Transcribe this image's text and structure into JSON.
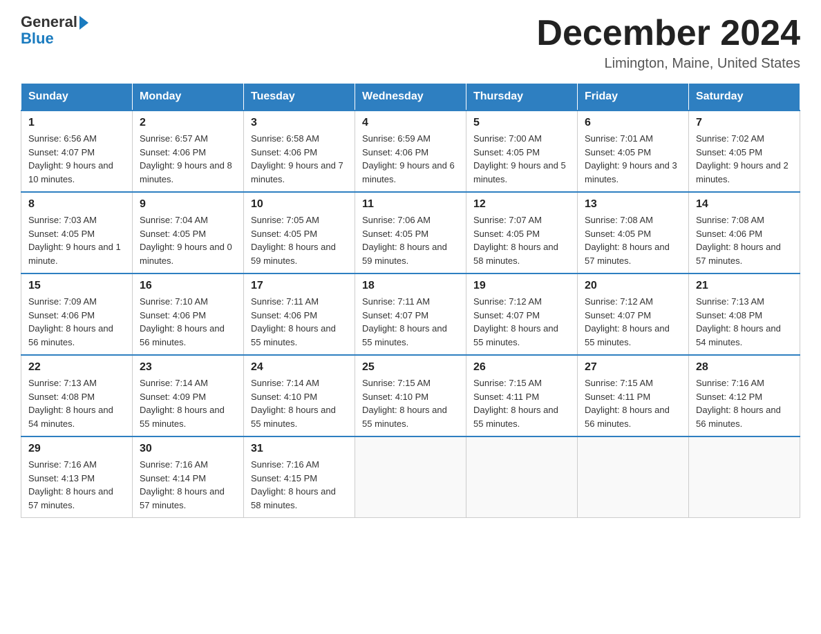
{
  "header": {
    "logo_text_general": "General",
    "logo_text_blue": "Blue",
    "month_title": "December 2024",
    "location": "Limington, Maine, United States"
  },
  "days_of_week": [
    "Sunday",
    "Monday",
    "Tuesday",
    "Wednesday",
    "Thursday",
    "Friday",
    "Saturday"
  ],
  "weeks": [
    [
      {
        "day": "1",
        "sunrise": "Sunrise: 6:56 AM",
        "sunset": "Sunset: 4:07 PM",
        "daylight": "Daylight: 9 hours and 10 minutes."
      },
      {
        "day": "2",
        "sunrise": "Sunrise: 6:57 AM",
        "sunset": "Sunset: 4:06 PM",
        "daylight": "Daylight: 9 hours and 8 minutes."
      },
      {
        "day": "3",
        "sunrise": "Sunrise: 6:58 AM",
        "sunset": "Sunset: 4:06 PM",
        "daylight": "Daylight: 9 hours and 7 minutes."
      },
      {
        "day": "4",
        "sunrise": "Sunrise: 6:59 AM",
        "sunset": "Sunset: 4:06 PM",
        "daylight": "Daylight: 9 hours and 6 minutes."
      },
      {
        "day": "5",
        "sunrise": "Sunrise: 7:00 AM",
        "sunset": "Sunset: 4:05 PM",
        "daylight": "Daylight: 9 hours and 5 minutes."
      },
      {
        "day": "6",
        "sunrise": "Sunrise: 7:01 AM",
        "sunset": "Sunset: 4:05 PM",
        "daylight": "Daylight: 9 hours and 3 minutes."
      },
      {
        "day": "7",
        "sunrise": "Sunrise: 7:02 AM",
        "sunset": "Sunset: 4:05 PM",
        "daylight": "Daylight: 9 hours and 2 minutes."
      }
    ],
    [
      {
        "day": "8",
        "sunrise": "Sunrise: 7:03 AM",
        "sunset": "Sunset: 4:05 PM",
        "daylight": "Daylight: 9 hours and 1 minute."
      },
      {
        "day": "9",
        "sunrise": "Sunrise: 7:04 AM",
        "sunset": "Sunset: 4:05 PM",
        "daylight": "Daylight: 9 hours and 0 minutes."
      },
      {
        "day": "10",
        "sunrise": "Sunrise: 7:05 AM",
        "sunset": "Sunset: 4:05 PM",
        "daylight": "Daylight: 8 hours and 59 minutes."
      },
      {
        "day": "11",
        "sunrise": "Sunrise: 7:06 AM",
        "sunset": "Sunset: 4:05 PM",
        "daylight": "Daylight: 8 hours and 59 minutes."
      },
      {
        "day": "12",
        "sunrise": "Sunrise: 7:07 AM",
        "sunset": "Sunset: 4:05 PM",
        "daylight": "Daylight: 8 hours and 58 minutes."
      },
      {
        "day": "13",
        "sunrise": "Sunrise: 7:08 AM",
        "sunset": "Sunset: 4:05 PM",
        "daylight": "Daylight: 8 hours and 57 minutes."
      },
      {
        "day": "14",
        "sunrise": "Sunrise: 7:08 AM",
        "sunset": "Sunset: 4:06 PM",
        "daylight": "Daylight: 8 hours and 57 minutes."
      }
    ],
    [
      {
        "day": "15",
        "sunrise": "Sunrise: 7:09 AM",
        "sunset": "Sunset: 4:06 PM",
        "daylight": "Daylight: 8 hours and 56 minutes."
      },
      {
        "day": "16",
        "sunrise": "Sunrise: 7:10 AM",
        "sunset": "Sunset: 4:06 PM",
        "daylight": "Daylight: 8 hours and 56 minutes."
      },
      {
        "day": "17",
        "sunrise": "Sunrise: 7:11 AM",
        "sunset": "Sunset: 4:06 PM",
        "daylight": "Daylight: 8 hours and 55 minutes."
      },
      {
        "day": "18",
        "sunrise": "Sunrise: 7:11 AM",
        "sunset": "Sunset: 4:07 PM",
        "daylight": "Daylight: 8 hours and 55 minutes."
      },
      {
        "day": "19",
        "sunrise": "Sunrise: 7:12 AM",
        "sunset": "Sunset: 4:07 PM",
        "daylight": "Daylight: 8 hours and 55 minutes."
      },
      {
        "day": "20",
        "sunrise": "Sunrise: 7:12 AM",
        "sunset": "Sunset: 4:07 PM",
        "daylight": "Daylight: 8 hours and 55 minutes."
      },
      {
        "day": "21",
        "sunrise": "Sunrise: 7:13 AM",
        "sunset": "Sunset: 4:08 PM",
        "daylight": "Daylight: 8 hours and 54 minutes."
      }
    ],
    [
      {
        "day": "22",
        "sunrise": "Sunrise: 7:13 AM",
        "sunset": "Sunset: 4:08 PM",
        "daylight": "Daylight: 8 hours and 54 minutes."
      },
      {
        "day": "23",
        "sunrise": "Sunrise: 7:14 AM",
        "sunset": "Sunset: 4:09 PM",
        "daylight": "Daylight: 8 hours and 55 minutes."
      },
      {
        "day": "24",
        "sunrise": "Sunrise: 7:14 AM",
        "sunset": "Sunset: 4:10 PM",
        "daylight": "Daylight: 8 hours and 55 minutes."
      },
      {
        "day": "25",
        "sunrise": "Sunrise: 7:15 AM",
        "sunset": "Sunset: 4:10 PM",
        "daylight": "Daylight: 8 hours and 55 minutes."
      },
      {
        "day": "26",
        "sunrise": "Sunrise: 7:15 AM",
        "sunset": "Sunset: 4:11 PM",
        "daylight": "Daylight: 8 hours and 55 minutes."
      },
      {
        "day": "27",
        "sunrise": "Sunrise: 7:15 AM",
        "sunset": "Sunset: 4:11 PM",
        "daylight": "Daylight: 8 hours and 56 minutes."
      },
      {
        "day": "28",
        "sunrise": "Sunrise: 7:16 AM",
        "sunset": "Sunset: 4:12 PM",
        "daylight": "Daylight: 8 hours and 56 minutes."
      }
    ],
    [
      {
        "day": "29",
        "sunrise": "Sunrise: 7:16 AM",
        "sunset": "Sunset: 4:13 PM",
        "daylight": "Daylight: 8 hours and 57 minutes."
      },
      {
        "day": "30",
        "sunrise": "Sunrise: 7:16 AM",
        "sunset": "Sunset: 4:14 PM",
        "daylight": "Daylight: 8 hours and 57 minutes."
      },
      {
        "day": "31",
        "sunrise": "Sunrise: 7:16 AM",
        "sunset": "Sunset: 4:15 PM",
        "daylight": "Daylight: 8 hours and 58 minutes."
      },
      null,
      null,
      null,
      null
    ]
  ]
}
